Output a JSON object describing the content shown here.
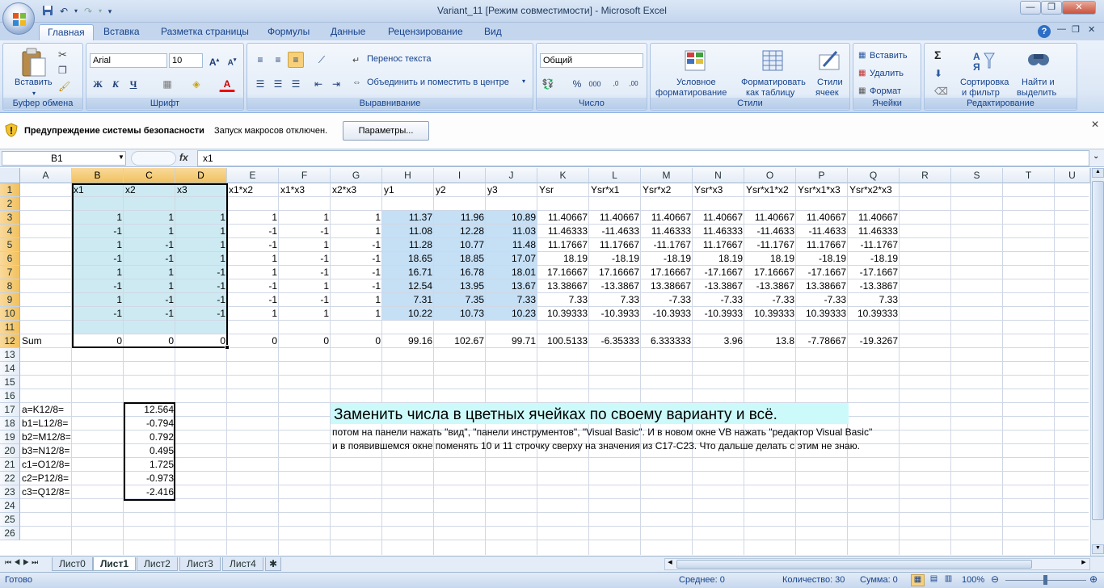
{
  "window": {
    "title": "Variant_11  [Режим совместимости] - Microsoft Excel"
  },
  "tabs": [
    "Главная",
    "Вставка",
    "Разметка страницы",
    "Формулы",
    "Данные",
    "Рецензирование",
    "Вид"
  ],
  "ribbon": {
    "clipboard": {
      "label": "Буфер обмена",
      "paste": "Вставить"
    },
    "font": {
      "label": "Шрифт",
      "name": "Arial",
      "size": "10"
    },
    "alignment": {
      "label": "Выравнивание",
      "wrap": "Перенос текста",
      "merge": "Объединить и поместить в центре"
    },
    "number": {
      "label": "Число",
      "format": "Общий"
    },
    "styles": {
      "label": "Стили",
      "cond1": "Условное",
      "cond2": "форматирование",
      "fmt1": "Форматировать",
      "fmt2": "как таблицу",
      "sty1": "Стили",
      "sty2": "ячеек"
    },
    "cells": {
      "label": "Ячейки",
      "insert": "Вставить",
      "delete": "Удалить",
      "format": "Формат"
    },
    "editing": {
      "label": "Редактирование",
      "sort1": "Сортировка",
      "sort2": "и фильтр",
      "find1": "Найти и",
      "find2": "выделить"
    }
  },
  "security": {
    "title": "Предупреждение системы безопасности",
    "message": "Запуск макросов отключен.",
    "button": "Параметры..."
  },
  "formula_bar": {
    "name_box": "B1",
    "fx": "fx",
    "value": "x1"
  },
  "columns": [
    "A",
    "B",
    "C",
    "D",
    "E",
    "F",
    "G",
    "H",
    "I",
    "J",
    "K",
    "L",
    "M",
    "N",
    "O",
    "P",
    "Q",
    "R",
    "S",
    "T",
    "U"
  ],
  "rows": [
    "1",
    "2",
    "3",
    "4",
    "5",
    "6",
    "7",
    "8",
    "9",
    "10",
    "11",
    "12",
    "13",
    "14",
    "15",
    "16",
    "17",
    "18",
    "19",
    "20",
    "21",
    "22",
    "23",
    "24",
    "25",
    "26"
  ],
  "headers": [
    "x1",
    "x2",
    "x3",
    "x1*x2",
    "x1*x3",
    "x2*x3",
    "y1",
    "y2",
    "y3",
    "Ysr",
    "Ysr*x1",
    "Ysr*x2",
    "Ysr*x3",
    "Ysr*x1*x2",
    "Ysr*x1*x3",
    "Ysr*x2*x3"
  ],
  "table": [
    [
      "1",
      "1",
      "1",
      "1",
      "1",
      "1",
      "11.37",
      "11.96",
      "10.89",
      "11.40667",
      "11.40667",
      "11.40667",
      "11.40667",
      "11.40667",
      "11.40667",
      "11.40667"
    ],
    [
      "-1",
      "1",
      "1",
      "-1",
      "-1",
      "1",
      "11.08",
      "12.28",
      "11.03",
      "11.46333",
      "-11.4633",
      "11.46333",
      "11.46333",
      "-11.4633",
      "-11.4633",
      "11.46333"
    ],
    [
      "1",
      "-1",
      "1",
      "-1",
      "1",
      "-1",
      "11.28",
      "10.77",
      "11.48",
      "11.17667",
      "11.17667",
      "-11.1767",
      "11.17667",
      "-11.1767",
      "11.17667",
      "-11.1767"
    ],
    [
      "-1",
      "-1",
      "1",
      "1",
      "-1",
      "-1",
      "18.65",
      "18.85",
      "17.07",
      "18.19",
      "-18.19",
      "-18.19",
      "18.19",
      "18.19",
      "-18.19",
      "-18.19"
    ],
    [
      "1",
      "1",
      "-1",
      "1",
      "-1",
      "-1",
      "16.71",
      "16.78",
      "18.01",
      "17.16667",
      "17.16667",
      "17.16667",
      "-17.1667",
      "17.16667",
      "-17.1667",
      "-17.1667"
    ],
    [
      "-1",
      "1",
      "-1",
      "-1",
      "1",
      "-1",
      "12.54",
      "13.95",
      "13.67",
      "13.38667",
      "-13.3867",
      "13.38667",
      "-13.3867",
      "-13.3867",
      "13.38667",
      "-13.3867"
    ],
    [
      "1",
      "-1",
      "-1",
      "-1",
      "-1",
      "1",
      "7.31",
      "7.35",
      "7.33",
      "7.33",
      "7.33",
      "-7.33",
      "-7.33",
      "-7.33",
      "-7.33",
      "7.33"
    ],
    [
      "-1",
      "-1",
      "-1",
      "1",
      "1",
      "1",
      "10.22",
      "10.73",
      "10.23",
      "10.39333",
      "-10.3933",
      "-10.3933",
      "-10.3933",
      "10.39333",
      "10.39333",
      "10.39333"
    ]
  ],
  "sum_label": "Sum",
  "sums": [
    "0",
    "0",
    "0",
    "0",
    "0",
    "0",
    "99.16",
    "102.67",
    "99.71",
    "100.5133",
    "-6.35333",
    "6.333333",
    "3.96",
    "13.8",
    "-7.78667",
    "-19.3267"
  ],
  "coeffs": [
    {
      "label": "a=K12/8=",
      "value": "12.564"
    },
    {
      "label": "b1=L12/8=",
      "value": "-0.794"
    },
    {
      "label": "b2=M12/8=",
      "value": "0.792"
    },
    {
      "label": "b3=N12/8=",
      "value": "0.495"
    },
    {
      "label": "c1=O12/8=",
      "value": "1.725"
    },
    {
      "label": "c2=P12/8=",
      "value": "-0.973"
    },
    {
      "label": "c3=Q12/8=",
      "value": "-2.416"
    }
  ],
  "note": {
    "heading": "Заменить числа в цветных ячейках по своему варианту и всё.",
    "line1": "потом на панели нажать \"вид\", \"панели инструментов\", \"Visual Basic\". И в новом окне VB нажать \"редактор Visual Basic\"",
    "line2": "и в появившемся окне поменять 10 и 11 строчку сверху на значения из C17-C23. Что дальше делать с этим не знаю."
  },
  "sheets": [
    "Лист0",
    "Лист1",
    "Лист2",
    "Лист3",
    "Лист4"
  ],
  "status": {
    "ready": "Готово",
    "average": "Среднее: 0",
    "count": "Количество: 30",
    "sum": "Сумма: 0",
    "zoom": "100%"
  },
  "colors": {
    "blue_fill": "#cdeaf2",
    "blue_fill2": "#c5dff5",
    "note_fill": "#ccfafa"
  }
}
